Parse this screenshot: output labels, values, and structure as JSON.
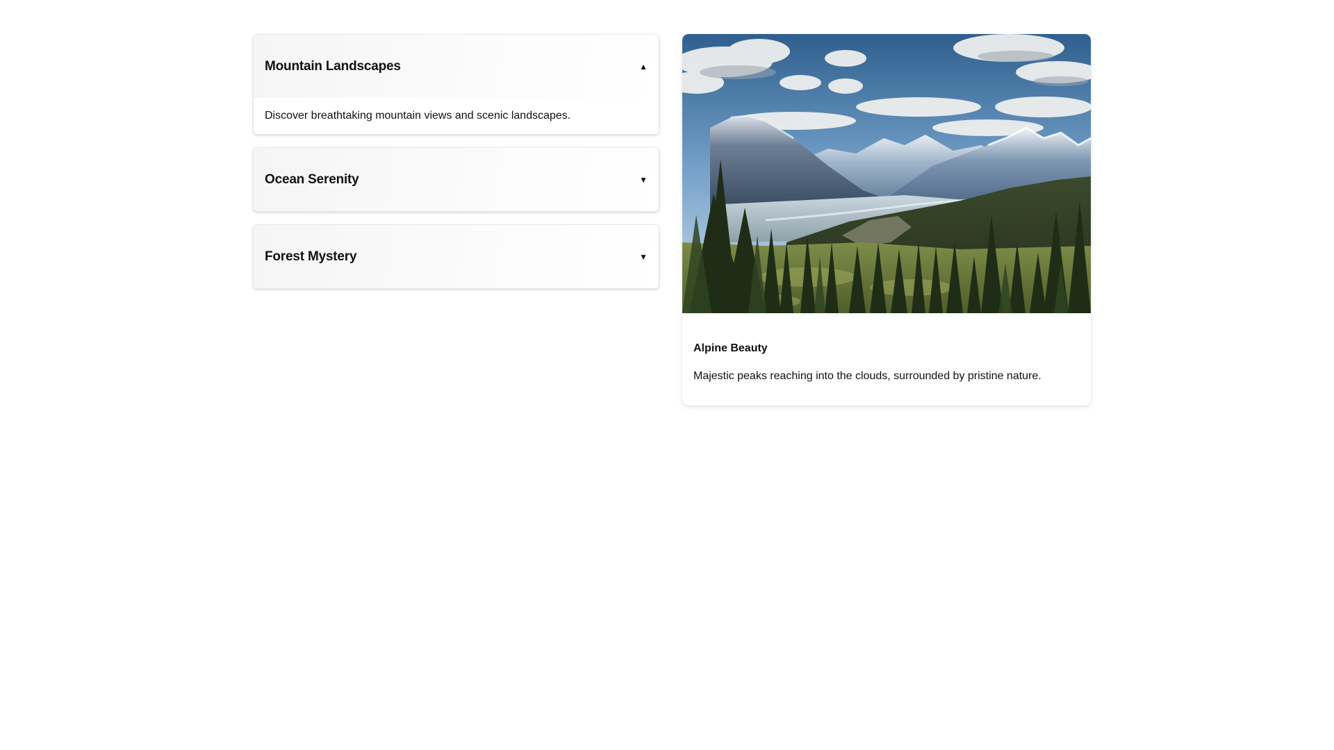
{
  "accordion": {
    "items": [
      {
        "title": "Mountain Landscapes",
        "arrow": "▲",
        "expanded": true,
        "content": "Discover breathtaking mountain views and scenic landscapes."
      },
      {
        "title": "Ocean Serenity",
        "arrow": "▼",
        "expanded": false
      },
      {
        "title": "Forest Mystery",
        "arrow": "▼",
        "expanded": false
      }
    ]
  },
  "card": {
    "image_icon": "mountain-landscape-photo",
    "title": "Alpine Beauty",
    "description": "Majestic peaks reaching into the clouds, surrounded by pristine nature."
  },
  "colors": {
    "page_background": "#ffffff",
    "header_background": "#f5f5f5",
    "text": "#111111"
  }
}
